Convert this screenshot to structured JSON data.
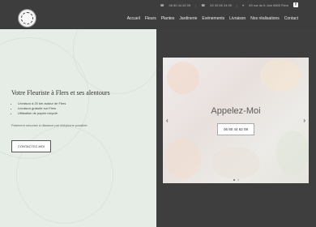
{
  "header": {
    "phone1": "06 80 44 62 09",
    "phone2": "02 33 65 24 09",
    "address": "69 rue du 6 Juin 6600 Flers",
    "nav": [
      "Accueil",
      "Fleurs",
      "Plantes",
      "Jardinerie",
      "Evénements",
      "Livraison",
      "Nos réalisations",
      "Contact"
    ]
  },
  "hero": {
    "title": "Votre Fleuriste à Flers et ses alentours",
    "bullets": [
      "Livraison à 20 km autour de Flers",
      "Livraison gratuite sur Flers",
      "Utilisation de papier recyclé"
    ],
    "note": "Paiement sécurisé à distance par téléphone possible",
    "cta": "CONTACTEZ-MOI"
  },
  "slider": {
    "title": "Appelez-Moi",
    "phone_button": "06 80 44 62 09",
    "prev": "‹",
    "next": "›"
  }
}
